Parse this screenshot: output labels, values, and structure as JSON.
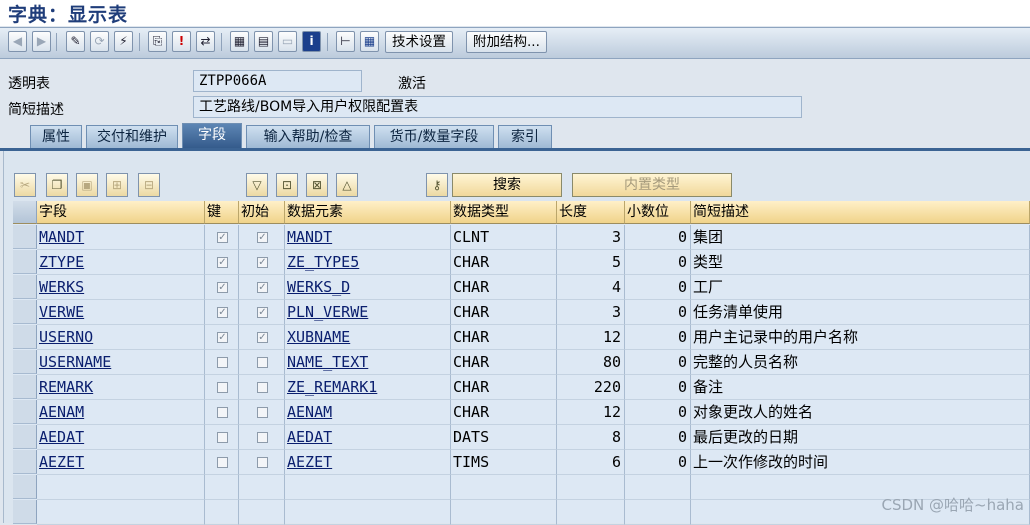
{
  "window": {
    "title": "字典：显示表"
  },
  "toolbar": {
    "icons": [
      "back-icon",
      "forward-icon",
      "edit-icon",
      "toggle-icon",
      "activate-icon",
      "other-object-icon",
      "check-icon",
      "where-used-icon",
      "hierarchy-icon",
      "layout-icon",
      "blank-icon",
      "info-icon",
      "structure-icon",
      "table-icon"
    ],
    "tech_settings_label": "技术设置",
    "append_struct_label": "附加结构..."
  },
  "header": {
    "table_label": "透明表",
    "table_name": "ZTPP066A",
    "status": "激活",
    "desc_label": "简短描述",
    "description": "工艺路线/BOM导入用户权限配置表"
  },
  "tabs": [
    {
      "label": "属性",
      "active": false
    },
    {
      "label": "交付和维护",
      "active": false
    },
    {
      "label": "字段",
      "active": true
    },
    {
      "label": "输入帮助/检查",
      "active": false
    },
    {
      "label": "货币/数量字段",
      "active": false
    },
    {
      "label": "索引",
      "active": false
    }
  ],
  "panel_toolbar": {
    "search_label": "搜索",
    "builtin_type_label": "内置类型"
  },
  "table": {
    "columns": [
      "字段",
      "键",
      "初始",
      "数据元素",
      "数据类型",
      "长度",
      "小数位",
      "简短描述"
    ],
    "rows": [
      {
        "field": "MANDT",
        "key": true,
        "initial": true,
        "element": "MANDT",
        "type": "CLNT",
        "length": "3",
        "decimals": "0",
        "desc": "集团"
      },
      {
        "field": "ZTYPE",
        "key": true,
        "initial": true,
        "element": "ZE_TYPE5",
        "type": "CHAR",
        "length": "5",
        "decimals": "0",
        "desc": "类型"
      },
      {
        "field": "WERKS",
        "key": true,
        "initial": true,
        "element": "WERKS_D",
        "type": "CHAR",
        "length": "4",
        "decimals": "0",
        "desc": "工厂"
      },
      {
        "field": "VERWE",
        "key": true,
        "initial": true,
        "element": "PLN_VERWE",
        "type": "CHAR",
        "length": "3",
        "decimals": "0",
        "desc": "任务清单使用"
      },
      {
        "field": "USERNO",
        "key": true,
        "initial": true,
        "element": "XUBNAME",
        "type": "CHAR",
        "length": "12",
        "decimals": "0",
        "desc": "用户主记录中的用户名称"
      },
      {
        "field": "USERNAME",
        "key": false,
        "initial": false,
        "element": "NAME_TEXT",
        "type": "CHAR",
        "length": "80",
        "decimals": "0",
        "desc": "完整的人员名称"
      },
      {
        "field": "REMARK",
        "key": false,
        "initial": false,
        "element": "ZE_REMARK1",
        "type": "CHAR",
        "length": "220",
        "decimals": "0",
        "desc": "备注"
      },
      {
        "field": "AENAM",
        "key": false,
        "initial": false,
        "element": "AENAM",
        "type": "CHAR",
        "length": "12",
        "decimals": "0",
        "desc": "对象更改人的姓名"
      },
      {
        "field": "AEDAT",
        "key": false,
        "initial": false,
        "element": "AEDAT",
        "type": "DATS",
        "length": "8",
        "decimals": "0",
        "desc": "最后更改的日期"
      },
      {
        "field": "AEZET",
        "key": false,
        "initial": false,
        "element": "AEZET",
        "type": "TIMS",
        "length": "6",
        "decimals": "0",
        "desc": "上一次作修改的时间"
      }
    ]
  },
  "watermark": "CSDN @哈哈~haha"
}
